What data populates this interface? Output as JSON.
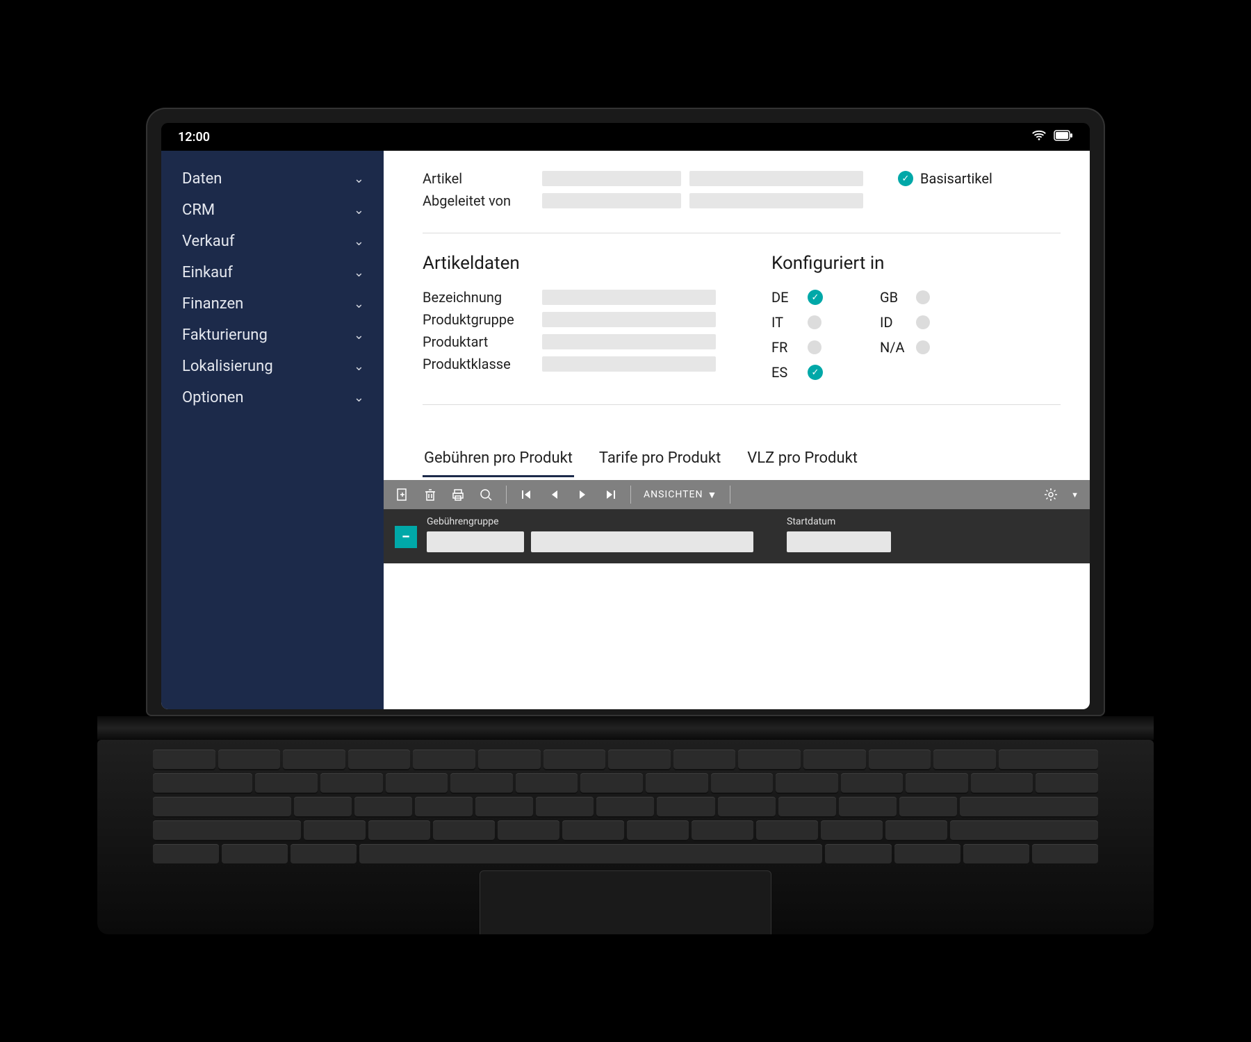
{
  "statusbar": {
    "time": "12:00"
  },
  "sidebar": {
    "items": [
      {
        "label": "Daten"
      },
      {
        "label": "CRM"
      },
      {
        "label": "Verkauf"
      },
      {
        "label": "Einkauf"
      },
      {
        "label": "Finanzen"
      },
      {
        "label": "Fakturierung"
      },
      {
        "label": "Lokalisierung"
      },
      {
        "label": "Optionen"
      }
    ]
  },
  "header": {
    "artikel_label": "Artikel",
    "abgeleitet_label": "Abgeleitet von",
    "basisartikel_label": "Basisartikel"
  },
  "artikeldaten": {
    "title": "Artikeldaten",
    "rows": [
      {
        "label": "Bezeichnung"
      },
      {
        "label": "Produktgruppe"
      },
      {
        "label": "Produktart"
      },
      {
        "label": "Produktklasse"
      }
    ]
  },
  "konfiguriert": {
    "title": "Konfiguriert in",
    "items": [
      {
        "code": "DE",
        "checked": true
      },
      {
        "code": "GB",
        "checked": false
      },
      {
        "code": "IT",
        "checked": false
      },
      {
        "code": "ID",
        "checked": false
      },
      {
        "code": "FR",
        "checked": false
      },
      {
        "code": "N/A",
        "checked": false
      },
      {
        "code": "ES",
        "checked": true
      }
    ]
  },
  "tabs": [
    {
      "label": "Gebühren pro Produkt",
      "active": true
    },
    {
      "label": "Tarife pro Produkt",
      "active": false
    },
    {
      "label": "VLZ pro Produkt",
      "active": false
    }
  ],
  "toolbar": {
    "ansichten_label": "ANSICHTEN"
  },
  "datarow": {
    "gebuhrengruppe_label": "Gebührengruppe",
    "startdatum_label": "Startdatum"
  }
}
